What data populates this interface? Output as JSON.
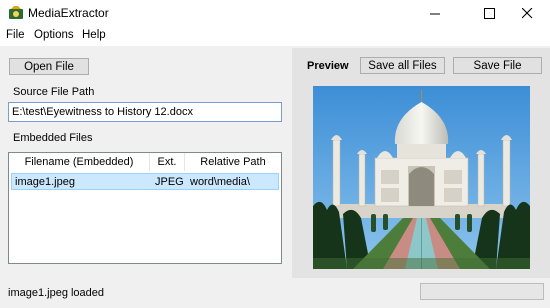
{
  "window": {
    "title": "MediaExtractor",
    "minimize_icon": "minimize-icon",
    "maximize_icon": "maximize-icon",
    "close_icon": "close-icon"
  },
  "menu": {
    "items": [
      "File",
      "Options",
      "Help"
    ]
  },
  "left": {
    "open_file_label": "Open File",
    "source_label": "Source File Path",
    "source_path": "E:\\test\\Eyewitness to History 12.docx",
    "embedded_label": "Embedded Files",
    "columns": [
      "Filename (Embedded)",
      "Ext.",
      "Relative Path"
    ],
    "rows": [
      {
        "filename": "image1.jpeg",
        "ext": "JPEG",
        "path": "word\\media\\"
      }
    ]
  },
  "preview": {
    "label": "Preview",
    "save_all_label": "Save all Files",
    "save_file_label": "Save File",
    "image_subject": "taj-mahal-photo"
  },
  "status": {
    "text": "image1.jpeg loaded",
    "progress": 0
  },
  "colors": {
    "selection": "#cce8ff",
    "sky": "#5aa8e0",
    "panel_bg": "#f0f0f0"
  }
}
